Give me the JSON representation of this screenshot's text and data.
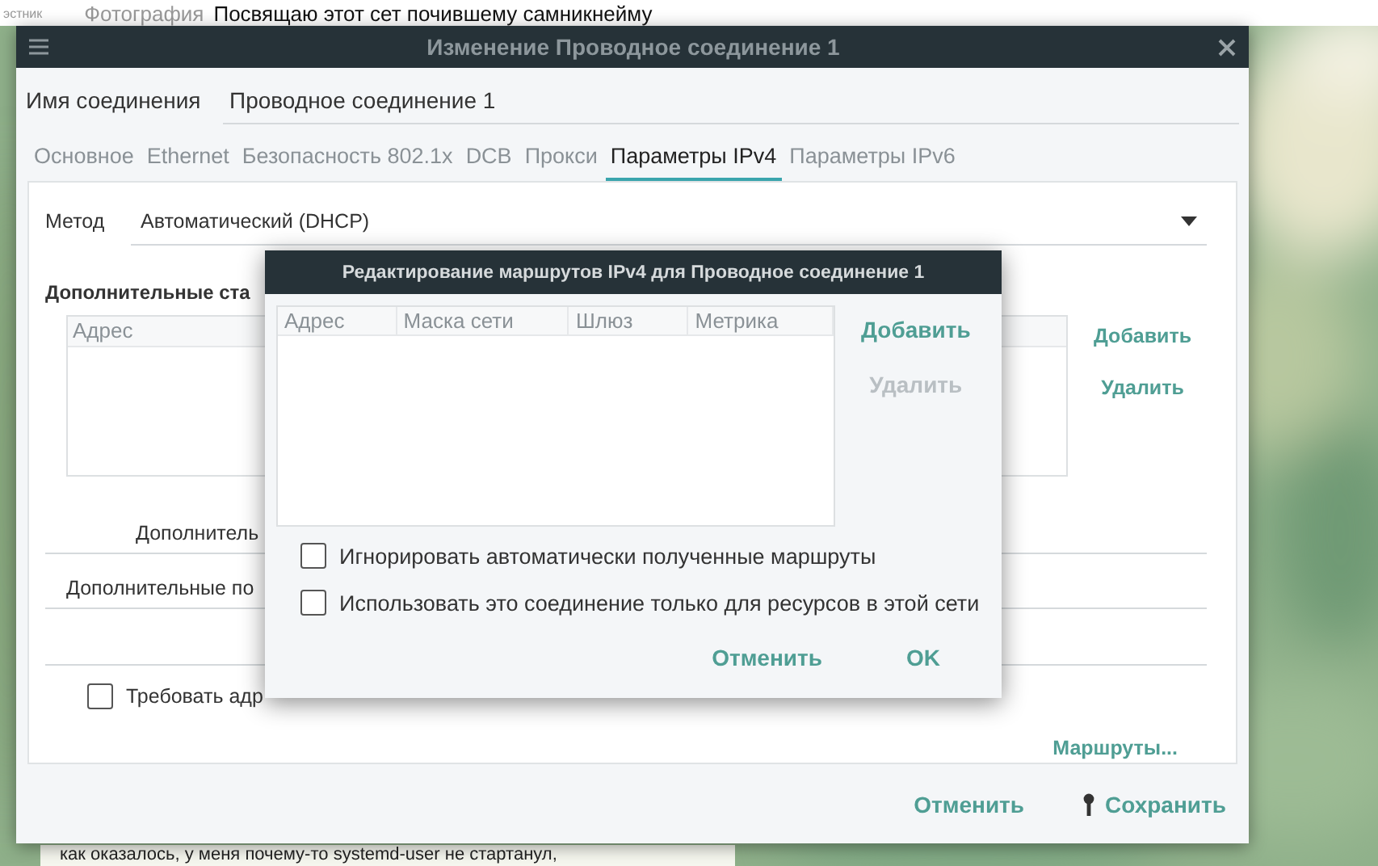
{
  "background_page": {
    "top_texts": [
      {
        "text": "эстник",
        "kind": "tiny"
      },
      {
        "text": "Фотография",
        "kind": "muted"
      },
      {
        "text": "Посвящаю этот сет почившему самникнейму",
        "kind": "plain"
      }
    ],
    "bottom_text": "как оказалось, у меня почему-то systemd-user не стартанул,"
  },
  "window": {
    "title": "Изменение Проводное соединение 1",
    "connection_name": {
      "label": "Имя соединения",
      "value": "Проводное соединение 1"
    },
    "tabs": [
      {
        "label": "Основное",
        "selected": false
      },
      {
        "label": "Ethernet",
        "selected": false
      },
      {
        "label": "Безопасность 802.1x",
        "selected": false
      },
      {
        "label": "DCB",
        "selected": false
      },
      {
        "label": "Прокси",
        "selected": false
      },
      {
        "label": "Параметры IPv4",
        "selected": true
      },
      {
        "label": "Параметры IPv6",
        "selected": false
      }
    ],
    "method": {
      "label": "Метод",
      "value": "Автоматический (DHCP)"
    },
    "section_title": "Дополнительные ста",
    "addresses_table": {
      "columns": [
        "Адрес"
      ]
    },
    "address_buttons": [
      {
        "label": "Добавить",
        "disabled": false
      },
      {
        "label": "Удалить",
        "disabled": false
      }
    ],
    "fields": [
      {
        "label": "Дополнитель",
        "kind": "indented"
      },
      {
        "label": "Дополнительные по",
        "kind": "plain"
      },
      {
        "kind": "unlabeled"
      }
    ],
    "checkbox": {
      "label": "Требовать адр",
      "checked": false
    },
    "routes_button": "Маршруты...",
    "footer_buttons": [
      {
        "label": "Отменить",
        "kind": "plain"
      },
      {
        "label": "Сохранить",
        "kind": "locked"
      }
    ]
  },
  "dialog": {
    "title": "Редактирование маршрутов IPv4 для Проводное соединение 1",
    "columns": [
      "Адрес",
      "Маска сети",
      "Шлюз",
      "Метрика"
    ],
    "buttons": [
      {
        "label": "Добавить",
        "disabled": false
      },
      {
        "label": "Удалить",
        "disabled": true
      }
    ],
    "checkboxes": [
      {
        "label": "Игнорировать автоматически полученные маршруты",
        "checked": false
      },
      {
        "label": "Использовать это соединение только для ресурсов в этой сети",
        "checked": false
      }
    ],
    "footer_buttons": [
      "Отменить",
      "OK"
    ]
  }
}
